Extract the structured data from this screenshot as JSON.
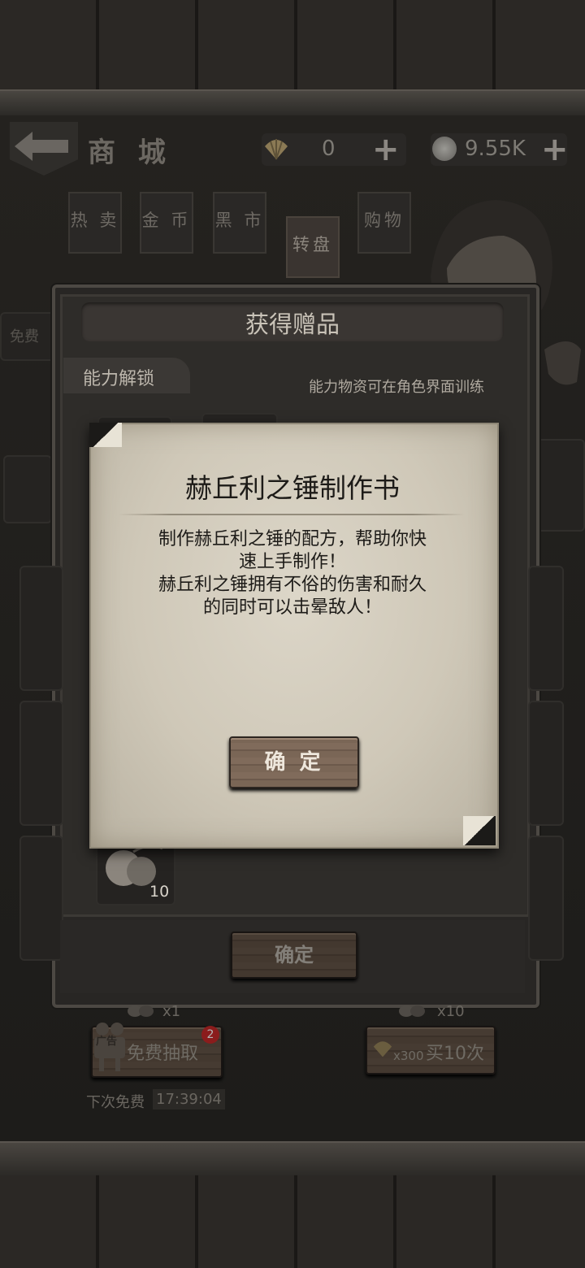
{
  "header": {
    "title": "商 城",
    "shell_amount": "0",
    "coin_amount": "9.55K"
  },
  "tabs": [
    {
      "label": "热 卖"
    },
    {
      "label": "金 币"
    },
    {
      "label": "黑 市"
    },
    {
      "label": "转盘"
    },
    {
      "label": "购物"
    }
  ],
  "left_hidden": {
    "free_tab": "免费"
  },
  "dialog": {
    "title": "获得赠品",
    "section_label": "能力解锁",
    "section_note": "能力物资可在角色界面训练",
    "item_count": "10",
    "confirm_label": "确定"
  },
  "popup": {
    "title": "赫丘利之锤制作书",
    "description_line1": "制作赫丘利之锤的配方，帮助你快",
    "description_line2": "速上手制作！",
    "description_line3": "赫丘利之锤拥有不俗的伤害和耐久",
    "description_line4": "的同时可以击晕敌人！",
    "confirm_label": "确 定"
  },
  "draw": {
    "single_cost": "x1",
    "ten_cost": "x10",
    "free_draw_label": "免费抽取",
    "ad_label": "广告",
    "badge_count": "2",
    "buy_ten_price": "x300",
    "buy_ten_label": "买10次",
    "next_free_label": "下次免费",
    "next_free_time": "17:39:04"
  },
  "colors": {
    "paper": "#d6d0c2",
    "wood_button": "#74604f",
    "badge": "#c62828",
    "background": "#1b1a18"
  }
}
